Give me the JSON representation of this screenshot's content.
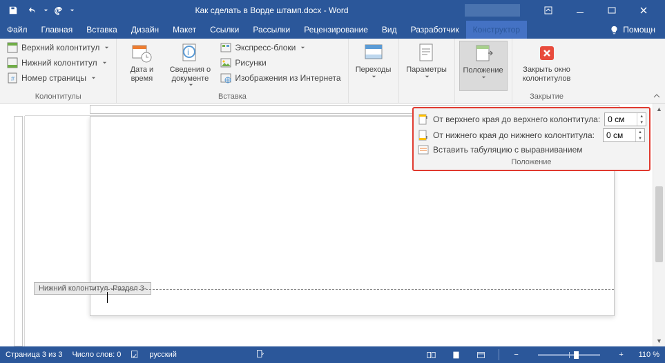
{
  "titlebar": {
    "title": "Как сделать в Ворде штамп.docx - Word"
  },
  "tabs": {
    "file": "Файл",
    "home": "Главная",
    "insert": "Вставка",
    "design": "Дизайн",
    "layout": "Макет",
    "references": "Ссылки",
    "mailings": "Рассылки",
    "review": "Рецензирование",
    "view": "Вид",
    "developer": "Разработчик",
    "constructor": "Конструктор",
    "help": "Помощн"
  },
  "ribbon": {
    "grp_colontitles": {
      "label": "Колонтитулы",
      "header": "Верхний колонтитул",
      "footer": "Нижний колонтитул",
      "pagenum": "Номер страницы"
    },
    "grp_insert": {
      "label": "Вставка",
      "datetime": "Дата и время",
      "docinfo": "Сведения о документе",
      "quickparts": "Экспресс-блоки",
      "pictures": "Рисунки",
      "onlinepics": "Изображения из Интернета"
    },
    "grp_nav": {
      "label": "",
      "transitions": "Переходы"
    },
    "grp_options": {
      "label": "",
      "options": "Параметры"
    },
    "grp_position": {
      "label": "",
      "position": "Положение"
    },
    "grp_close": {
      "label": "Закрытие",
      "close": "Закрыть окно колонтитулов"
    }
  },
  "pospanel": {
    "top_label": "От верхнего края до верхнего колонтитула:",
    "bottom_label": "От нижнего края до нижнего колонтитула:",
    "tab_label": "Вставить табуляцию с выравниванием",
    "top_value": "0 см",
    "bottom_value": "0 см",
    "group_label": "Положение"
  },
  "document": {
    "footer_tag": "Нижний колонтитул -Раздел 3-"
  },
  "status": {
    "page": "Страница 3 из 3",
    "words": "Число слов: 0",
    "lang": "русский",
    "zoom": "110 %"
  }
}
